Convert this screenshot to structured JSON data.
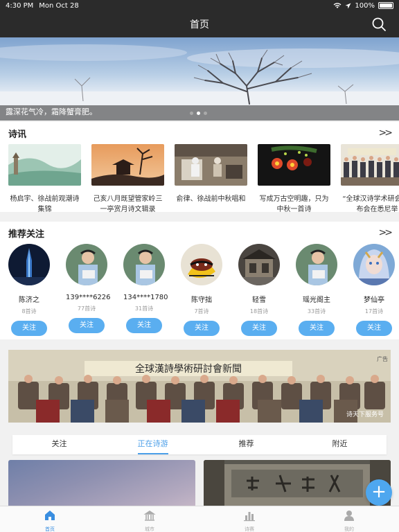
{
  "status": {
    "time": "4:30 PM",
    "date": "Mon Oct 28",
    "battery": "100%",
    "battery_level": 1.0
  },
  "nav": {
    "title": "首页",
    "search_icon": "search-icon"
  },
  "banner": {
    "caption": "露深花气冷，霜降蟹膏肥。",
    "page_count": 3,
    "current_page": 1
  },
  "news": {
    "title": "诗讯",
    "items": [
      {
        "text": "杨启宇、徐战前观潮诗集锦"
      },
      {
        "text": "己亥八月既望管家岭三一亭赏月诗文辑录"
      },
      {
        "text": "俞律、徐战前中秋唱和"
      },
      {
        "text": "写成万古空明趣，只为中秋一首诗"
      },
      {
        "text": "“全球汉诗学术研会”发布会在悉尼举"
      }
    ]
  },
  "follow": {
    "title": "推荐关注",
    "button_label": "关注",
    "items": [
      {
        "name": "陈济之",
        "count": "8首诗"
      },
      {
        "name": "139****6226",
        "count": "77首诗"
      },
      {
        "name": "134****1780",
        "count": "31首诗"
      },
      {
        "name": "陈守拙",
        "count": "7首诗"
      },
      {
        "name": "轻雪",
        "count": "18首诗"
      },
      {
        "name": "瑶光阁主",
        "count": "33首诗"
      },
      {
        "name": "梦仙亭",
        "count": "17首诗"
      }
    ]
  },
  "ad": {
    "label": "广告",
    "banner_text": "全球漢詩學術研討會新聞",
    "watermark": "诗天下服务号"
  },
  "tabs": {
    "items": [
      "关注",
      "正在诗游",
      "推荐",
      "附近"
    ],
    "active": 1
  },
  "fab": {
    "label": "+"
  },
  "tabbar": {
    "items": [
      {
        "label": "首页",
        "icon": "home-icon",
        "active": true
      },
      {
        "label": "城市",
        "icon": "city-icon",
        "active": false
      },
      {
        "label": "诗赛",
        "icon": "chart-icon",
        "active": false
      },
      {
        "label": "我的",
        "icon": "person-icon",
        "active": false
      }
    ]
  },
  "colors": {
    "accent": "#4a9ee8",
    "follow_button": "#5aaef0",
    "bar": "#2b2b2b"
  }
}
